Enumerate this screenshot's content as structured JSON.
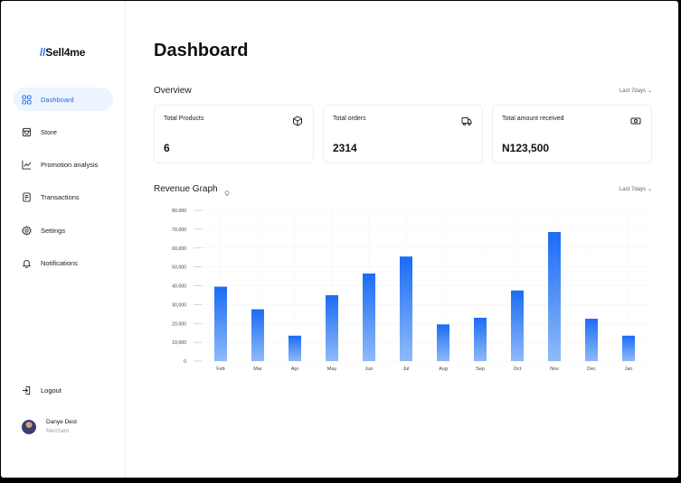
{
  "brand": {
    "slash": "//",
    "name": "Sell4me"
  },
  "sidebar": {
    "items": [
      {
        "label": "Dashboard",
        "icon": "grid-icon",
        "active": true
      },
      {
        "label": "Store",
        "icon": "store-icon",
        "active": false
      },
      {
        "label": "Promotion analysis",
        "icon": "trend-icon",
        "active": false
      },
      {
        "label": "Transactions",
        "icon": "document-icon",
        "active": false
      },
      {
        "label": "Settings",
        "icon": "gear-icon",
        "active": false
      },
      {
        "label": "Notifications",
        "icon": "bell-icon",
        "active": false
      }
    ],
    "logout": "Logout",
    "user": {
      "name": "Danye Dest",
      "role": "Merchant"
    }
  },
  "main": {
    "title": "Dashboard",
    "overview": {
      "title": "Overview",
      "range": "Last 7days",
      "cards": [
        {
          "label": "Total Products",
          "value": "6",
          "icon": "box-icon"
        },
        {
          "label": "Total orders",
          "value": "2314",
          "icon": "truck-icon"
        },
        {
          "label": "Total amount received",
          "value": "N123,500",
          "icon": "money-icon"
        }
      ]
    },
    "revenue": {
      "title": "Revenue Graph",
      "range": "Last 7days"
    }
  },
  "colors": {
    "accent": "#1d6cf0",
    "bar_top": "#1a6cf5",
    "bar_bottom": "#8fbaf8"
  },
  "chart_data": {
    "type": "bar",
    "categories": [
      "Feb",
      "Mar",
      "Apr",
      "May",
      "Jun",
      "Jul",
      "Aug",
      "Sep",
      "Oct",
      "Nov",
      "Dec",
      "Jan"
    ],
    "values": [
      39500,
      27500,
      13500,
      35000,
      46500,
      55500,
      19500,
      23000,
      37500,
      68500,
      22500,
      13500
    ],
    "yticks": [
      "0",
      "10,000",
      "20,000",
      "30,000",
      "40,000",
      "50,000",
      "60,000",
      "70,000",
      "80,000"
    ],
    "ylim": [
      0,
      80000
    ],
    "grid": true
  }
}
